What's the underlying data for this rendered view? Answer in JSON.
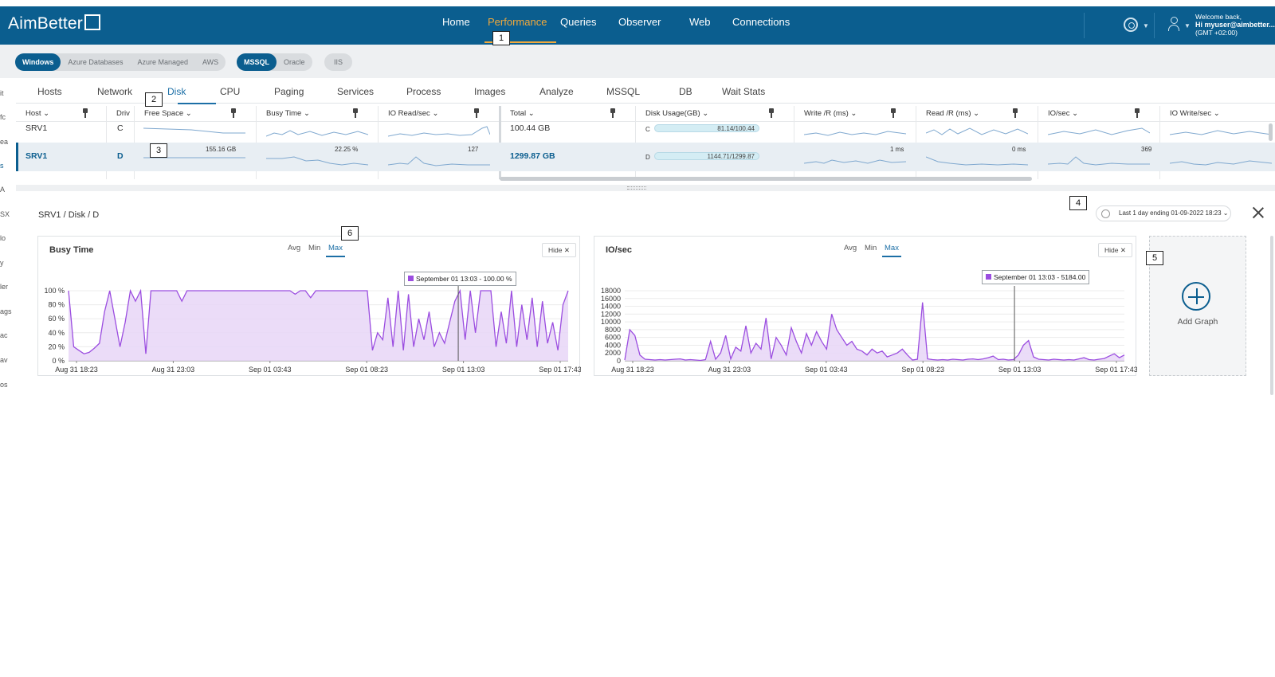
{
  "app": {
    "logo": "AimBetter",
    "nav": [
      {
        "label": "Home"
      },
      {
        "label": "Performance",
        "active": true
      },
      {
        "label": "Queries"
      },
      {
        "label": "Observer"
      },
      {
        "label": "Web"
      },
      {
        "label": "Connections"
      }
    ],
    "user": {
      "welcome": "Welcome back,",
      "greeting": "Hi myuser@aimbetter....",
      "timezone": "(GMT +02:00)"
    },
    "colors": {
      "brand": "#0b5e8f",
      "accent": "#f2a93b",
      "series": "#9b4de0"
    }
  },
  "callouts": [
    "1",
    "2",
    "3",
    "4",
    "5",
    "6"
  ],
  "filters": {
    "platforms": [
      "Windows",
      "Azure Databases",
      "Azure Managed",
      "AWS"
    ],
    "engines": [
      "MSSQL",
      "Oracle"
    ],
    "other": [
      "IIS"
    ]
  },
  "left_strip": [
    "it",
    "fc",
    "ea",
    "s",
    "A",
    "SX",
    "lo",
    "y",
    "ler",
    "ags",
    "ac",
    "av",
    "os"
  ],
  "tabs": [
    "Hosts",
    "Network",
    "Disk",
    "CPU",
    "Paging",
    "Services",
    "Process",
    "Images",
    "Analyze",
    "MSSQL",
    "DB",
    "Wait Stats"
  ],
  "grid": {
    "columns": [
      "Host",
      "Driv",
      "Free Space",
      "Busy Time",
      "IO Read/sec",
      "Total",
      "Disk Usage(GB)",
      "Write /R (ms)",
      "Read /R (ms)",
      "IO/sec",
      "IO Write/sec"
    ],
    "rows": [
      {
        "host": "SRV1",
        "drive": "C",
        "free_space": "",
        "busy_time": "",
        "io_read": "",
        "total": "100.44 GB",
        "usage_drive": "C",
        "usage": "81.14/100.44",
        "usage_pct": 0.81,
        "write": "",
        "read": "",
        "io_sec": ""
      },
      {
        "host": "SRV1",
        "drive": "D",
        "free_space": "155.16 GB",
        "busy_time": "22.25 %",
        "io_read": "127",
        "total": "1299.87 GB",
        "usage_drive": "D",
        "usage": "1144.71/1299.87",
        "usage_pct": 0.88,
        "write": "1 ms",
        "read": "0 ms",
        "io_sec": "369",
        "selected": true
      }
    ]
  },
  "detail": {
    "breadcrumb": "SRV1 / Disk / D",
    "date_range": "Last 1 day ending 01-09-2022 18:23 ⌄",
    "add_graph": "Add Graph",
    "agg_tabs": [
      "Avg",
      "Min",
      "Max"
    ],
    "active_agg": "Max",
    "hide_label": "Hide ✕"
  },
  "chart_data": [
    {
      "type": "area",
      "title": "Busy Time",
      "x_ticks": [
        "Aug 31 18:23",
        "Aug 31 23:03",
        "Sep 01 03:43",
        "Sep 01 08:23",
        "Sep 01 13:03",
        "Sep 01 17:43"
      ],
      "y_ticks": [
        "0 %",
        "20 %",
        "40 %",
        "60 %",
        "80 %",
        "100 %"
      ],
      "ylim": [
        0,
        100
      ],
      "tooltip": "September 01 13:03 - 100.00 %",
      "cursor_fraction": 0.78,
      "series": [
        {
          "values": [
            100,
            20,
            15,
            10,
            12,
            18,
            25,
            70,
            100,
            60,
            20,
            55,
            100,
            85,
            100,
            10,
            100,
            100,
            100,
            100,
            100,
            100,
            85,
            100,
            100,
            100,
            100,
            100,
            100,
            100,
            100,
            100,
            100,
            100,
            100,
            100,
            100,
            100,
            100,
            100,
            100,
            100,
            100,
            100,
            95,
            100,
            100,
            90,
            100,
            100,
            100,
            100,
            100,
            100,
            100,
            100,
            100,
            100,
            100,
            15,
            40,
            30,
            90,
            20,
            100,
            15,
            95,
            20,
            60,
            30,
            70,
            20,
            40,
            25,
            55,
            85,
            100,
            30,
            100,
            40,
            100,
            100,
            100,
            20,
            70,
            25,
            100,
            20,
            80,
            30,
            90,
            20,
            85,
            25,
            55,
            15,
            80,
            100
          ]
        }
      ]
    },
    {
      "type": "area",
      "title": "IO/sec",
      "x_ticks": [
        "Aug 31 18:23",
        "Aug 31 23:03",
        "Sep 01 03:43",
        "Sep 01 08:23",
        "Sep 01 13:03",
        "Sep 01 17:43"
      ],
      "y_ticks": [
        "0",
        "2000",
        "4000",
        "6000",
        "8000",
        "10000",
        "12000",
        "14000",
        "16000",
        "18000"
      ],
      "ylim": [
        0,
        18000
      ],
      "tooltip": "September 01 13:03 - 5184.00",
      "cursor_fraction": 0.78,
      "series": [
        {
          "values": [
            200,
            8000,
            6500,
            1500,
            400,
            300,
            200,
            300,
            200,
            300,
            400,
            500,
            200,
            300,
            200,
            100,
            300,
            5000,
            400,
            2000,
            6500,
            500,
            3500,
            2500,
            9000,
            2000,
            4500,
            3000,
            11000,
            500,
            6000,
            4000,
            1500,
            8500,
            5000,
            2000,
            7000,
            4000,
            7500,
            5000,
            3000,
            12000,
            8000,
            6000,
            4000,
            5000,
            3000,
            2500,
            1500,
            3000,
            2000,
            2500,
            1000,
            1500,
            2000,
            3000,
            1500,
            200,
            400,
            15000,
            500,
            300,
            200,
            300,
            200,
            400,
            300,
            200,
            400,
            500,
            300,
            500,
            800,
            1200,
            300,
            400,
            200,
            300,
            1500,
            4000,
            5200,
            1000,
            400,
            300,
            200,
            400,
            300,
            200,
            300,
            200,
            500,
            800,
            300,
            200,
            400,
            600,
            1200,
            1800,
            800,
            1500
          ]
        }
      ]
    }
  ]
}
